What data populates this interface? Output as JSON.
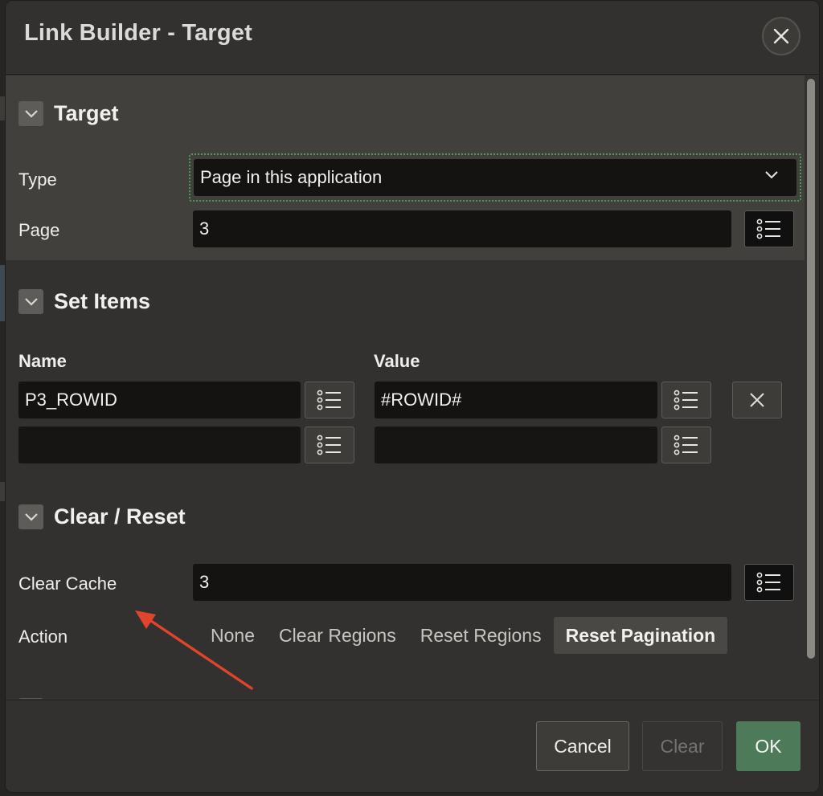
{
  "dialog": {
    "title": "Link Builder - Target"
  },
  "sections": {
    "target": {
      "title": "Target",
      "type_label": "Type",
      "type_value": "Page in this application",
      "page_label": "Page",
      "page_value": "3"
    },
    "set_items": {
      "title": "Set Items",
      "name_header": "Name",
      "value_header": "Value",
      "rows": [
        {
          "name": "P3_ROWID",
          "value": "#ROWID#"
        },
        {
          "name": "",
          "value": ""
        }
      ]
    },
    "clear_reset": {
      "title": "Clear / Reset",
      "clear_cache_label": "Clear Cache",
      "clear_cache_value": "3",
      "action_label": "Action",
      "actions": [
        "None",
        "Clear Regions",
        "Reset Regions",
        "Reset Pagination"
      ],
      "active_action": "Reset Pagination"
    }
  },
  "footer": {
    "cancel_label": "Cancel",
    "clear_label": "Clear",
    "ok_label": "OK"
  },
  "icons": {
    "close": "close-icon",
    "collapse": "chevron-down-icon",
    "list": "list-icon",
    "remove": "x-icon"
  },
  "colors": {
    "ok_button": "#4d7b5a",
    "focus_outline": "#4a9a5a",
    "annotation_arrow": "#e0442c"
  }
}
